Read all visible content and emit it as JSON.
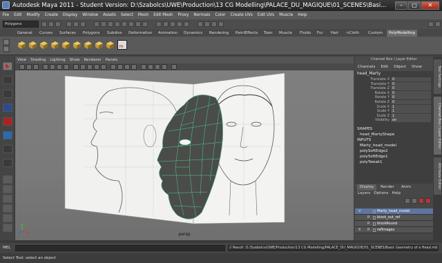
{
  "window": {
    "title": "Autodesk Maya 2011 - Student Version: D:\\Szabolcs\\UWE\\Production\\13 CG Modelling\\PALACE_DU_MAGIQUE\\01_SCENES\\Basi...",
    "controls": [
      "–",
      "□",
      "✕"
    ]
  },
  "menubar": [
    "File",
    "Edit",
    "Modify",
    "Create",
    "Display",
    "Window",
    "Assets",
    "Select",
    "Mesh",
    "Edit Mesh",
    "Proxy",
    "Normals",
    "Color",
    "Create UVs",
    "Edit UVs",
    "Muscle",
    "Help"
  ],
  "status": {
    "mode": "Polygons"
  },
  "shelf": {
    "tabs": [
      "General",
      "Curves",
      "Surfaces",
      "Polygons",
      "Subdivs",
      "Deformation",
      "Animation",
      "Dynamics",
      "Rendering",
      "PaintEffects",
      "Toon",
      "Muscle",
      "Fluids",
      "Fur",
      "Hair",
      "nCloth",
      "Custom",
      "PolyModelling"
    ],
    "active_tab": "PolyModelling",
    "icons": [
      "cube-icon",
      "cube-icon",
      "cube-icon",
      "cube-icon",
      "cube-icon",
      "cube-icon",
      "cube-icon",
      "cube-icon",
      "cube-icon",
      "hi-icon"
    ],
    "hi_label": "Hi"
  },
  "panel": {
    "menu": [
      "View",
      "Shading",
      "Lighting",
      "Show",
      "Renderer",
      "Panels"
    ],
    "camera": "persp"
  },
  "channel_box": {
    "title": "Channel Box / Layer Editor",
    "menu": [
      "Channels",
      "Edit",
      "Object",
      "Show"
    ],
    "object": "head_Marty",
    "attributes": [
      {
        "name": "Translate X",
        "value": "0"
      },
      {
        "name": "Translate Y",
        "value": "0"
      },
      {
        "name": "Translate Z",
        "value": "0"
      },
      {
        "name": "Rotate X",
        "value": "0"
      },
      {
        "name": "Rotate Y",
        "value": "0"
      },
      {
        "name": "Rotate Z",
        "value": "0"
      },
      {
        "name": "Scale X",
        "value": "1"
      },
      {
        "name": "Scale Y",
        "value": "1"
      },
      {
        "name": "Scale Z",
        "value": "1"
      },
      {
        "name": "Visibility",
        "value": "on"
      }
    ],
    "shapes_header": "SHAPES",
    "shape": "head_MartyShape",
    "inputs_header": "INPUTS",
    "inputs": [
      "Marty_head_model",
      "polySoftEdge2",
      "polySoftEdge1",
      "polyTweak1"
    ]
  },
  "side_tabs": [
    "Tool Settings",
    "Channel Box / Layer Editor",
    "Attribute Editor"
  ],
  "layer_editor": {
    "tabs": [
      "Display",
      "Render",
      "Anim"
    ],
    "active_tab": "Display",
    "menu": [
      "Layers",
      "Options",
      "Help"
    ],
    "rows": [
      {
        "visible": "V",
        "ref": "",
        "name": "Marty_head_model",
        "color": "#5d76a0",
        "selected": true
      },
      {
        "visible": "",
        "ref": "R",
        "name": "block_out_ref",
        "color": "#555555",
        "selected": false
      },
      {
        "visible": "",
        "ref": "R",
        "name": "blockRound",
        "color": "#555555",
        "selected": false
      },
      {
        "visible": "X",
        "ref": "R",
        "name": "refImages",
        "color": "#555555",
        "selected": false
      }
    ]
  },
  "command_line": {
    "label": "MEL",
    "result": "// Result: D:/Szabolcs/UWE/Production/13 CG Modelling/PALACE_DU_MAGIQUE/01_SCENES/Basic Geometry of a Head.mb"
  },
  "help_line": "Select Tool: select an object"
}
